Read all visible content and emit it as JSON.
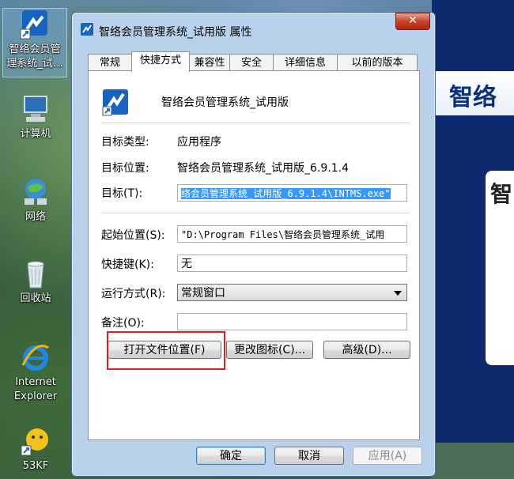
{
  "desktop": {
    "icons": [
      {
        "label": "智络会员管\n理系统_试…",
        "icon": "app-shortcut-icon"
      },
      {
        "label": "计算机",
        "icon": "computer-icon"
      },
      {
        "label": "网络",
        "icon": "network-icon"
      },
      {
        "label": "回收站",
        "icon": "recycle-bin-icon"
      },
      {
        "label": "Internet\nExplorer",
        "icon": "internet-explorer-icon"
      },
      {
        "label": "53KF",
        "icon": "53kf-icon"
      }
    ]
  },
  "background_app": {
    "banner_text": "智络",
    "panel_char": "智"
  },
  "dialog": {
    "title": "智络会员管理系统_试用版 属性",
    "close_label": "✕",
    "tabs": [
      "常规",
      "快捷方式",
      "兼容性",
      "安全",
      "详细信息",
      "以前的版本"
    ],
    "active_tab": "快捷方式",
    "app_name": "智络会员管理系统_试用版",
    "fields": {
      "target_type_label": "目标类型:",
      "target_type_value": "应用程序",
      "target_location_label": "目标位置:",
      "target_location_value": "智络会员管理系统_试用版_6.9.1.4",
      "target_label": "目标(T):",
      "target_value": "络会员管理系统_试用版_6.9.1.4\\INTMS.exe\"",
      "start_in_label": "起始位置(S):",
      "start_in_value": "\"D:\\Program Files\\智络会员管理系统_试用",
      "shortcut_key_label": "快捷键(K):",
      "shortcut_key_value": "无",
      "run_label": "运行方式(R):",
      "run_value": "常规窗口",
      "comment_label": "备注(O):",
      "comment_value": ""
    },
    "buttons": {
      "open_location": "打开文件位置(F)",
      "change_icon": "更改图标(C)...",
      "advanced": "高级(D)...",
      "ok": "确定",
      "cancel": "取消",
      "apply": "应用(A)"
    }
  },
  "colors": {
    "highlight_box": "#e02020",
    "selection": "#3399ff",
    "dialog_frame": "#b9d1ea"
  }
}
